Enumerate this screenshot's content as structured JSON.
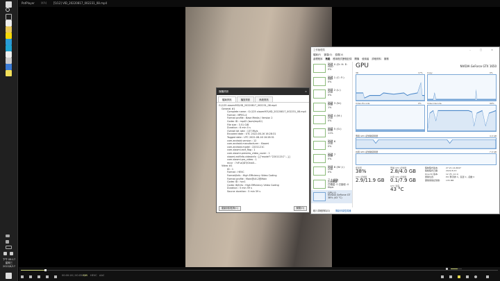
{
  "taskbar": {
    "clock": {
      "time": "下午 08:17",
      "weekday": "星期三",
      "date": "2022/8/17"
    }
  },
  "player": {
    "app": "PotPlayer",
    "format": "MP4",
    "file": "[5/12] VID_20220817_002231_08.mp4",
    "time": "00:00:16 / 00:05:59",
    "hw": "H/W",
    "video_codec": "HEVC",
    "audio_codec": "AAC",
    "progress": 0.05,
    "volume": 0.6,
    "colors": {
      "accent": "#cfd77a"
    }
  },
  "media_info": {
    "title": "媒體資訊",
    "close": "×",
    "tabs": [
      "檔案資訊",
      "播放資訊",
      "系統資訊"
    ],
    "file": "G:\\125 xiaomi93\\VID_20220817_002231_08.mp4",
    "general_header": "General #1",
    "general": [
      "Complete name : G:\\125 xiaomi93\\VID_20220817_002231_08.mp4",
      "Format : MPEG-4",
      "Format profile : Base Media / Version 2",
      "Codec ID : mp42 (isom/mp42)",
      "File size : 3.51 GiB",
      "Duration : 6 min 0 s",
      "Overall bit rate : 137 Mb/s",
      "Encoded date : UTC 2022-08-16 16:28:31",
      "Tagged date : UTC 2022-08-16 16:28:31",
      "com.android.version : 12",
      "com.android.manufacturer : Xiaomi",
      "com.android.model : 2201121C",
      "com.xiaomi.exif_flag : 1",
      "com.xiaomi.preview_video_cover : 1",
      "xiaomi.exifInfo.videoinfo : [{\"model\":\"2201121C\"...}]",
      "com.xiaomi.pro_video : 1",
      "mcvr : ?nP-aQD?/Ghw0..."
    ],
    "video_header": "Video #1",
    "video": [
      "ID : 1",
      "Format : HEVC",
      "Format/Info : High Efficiency Video Coding",
      "Format profile : Main@L6.2@Main",
      "Codec ID : hvc1",
      "Codec ID/Info : High Efficiency Video Coding",
      "Duration : 5 min 59 s",
      "Source duration : 5 min 59 s"
    ],
    "copy_button": "複製到剪貼簿(C)",
    "close_button": "關閉(O)"
  },
  "task_manager": {
    "title": "工作管理員",
    "window_controls": "– □ ×",
    "menu": [
      "檔案(F)",
      "選項(O)",
      "檢視(V)"
    ],
    "tabs": [
      "處理程序",
      "效能",
      "應用程式歷程記錄",
      "開機",
      "使用者",
      "詳細資料",
      "服務"
    ],
    "devices": [
      {
        "name": "磁碟 0 (D: H: E:",
        "type": "HDD",
        "value": "0%"
      },
      {
        "name": "磁碟 1 (C: F:)",
        "type": "SSD",
        "value": "0%"
      },
      {
        "name": "磁碟 2 (L:)",
        "type": "USB",
        "value": "0%"
      },
      {
        "name": "磁碟 3 (N:)",
        "type": "USB",
        "value": "1%"
      },
      {
        "name": "磁碟 4 (M:)",
        "type": "USB",
        "value": "0%"
      },
      {
        "name": "磁碟 5 (G:)",
        "type": "USB",
        "value": "11%"
      },
      {
        "name": "磁碟 6",
        "type": "USB",
        "value": "0%"
      },
      {
        "name": "磁碟 7",
        "type": "USB",
        "value": "0%"
      },
      {
        "name": "磁碟 8 (W: J:)",
        "type": "USB",
        "value": "0%"
      },
      {
        "name": "乙太網路",
        "type": "乙太網路",
        "value": "已傳送: 0 已接收: 0 Kbps"
      },
      {
        "name": "GPU 0",
        "type": "NVIDIA GeForce GT",
        "value": "38% (43 °C)"
      }
    ],
    "gpu": {
      "heading": "GPU",
      "model": "NVIDIA GeForce GTX 1650",
      "graphs": [
        {
          "label": "3D",
          "max": "17%"
        },
        {
          "label": "Copy",
          "max": "0%"
        },
        {
          "label": "Video Encode",
          "max": "0%"
        },
        {
          "label": "Video Decode",
          "max": "99%"
        }
      ],
      "dedicated_label": "專用 GPU 記憶體使用量",
      "dedicated_max": "4.0 GB",
      "shared_label": "共用 GPU 記憶體使用量",
      "shared_max": "7.9 GB",
      "stats": [
        {
          "label": "使用率",
          "value": "38%"
        },
        {
          "label": "專屬 GPU 記憶體",
          "value": "2.8/4.0 GB"
        },
        {
          "label": "GPU 記憶體",
          "value": "2.9/11.9 GB"
        },
        {
          "label": "共用 GPU 記憶體",
          "value": "0.1/7.9 GB"
        },
        {
          "label": "GPU 溫度",
          "value": "43 °C"
        }
      ],
      "info": [
        [
          "驅動程式版本:",
          "27.21.14.6647"
        ],
        [
          "驅動程式日期:",
          "2021/5/13"
        ],
        [
          "DirectX 版本:",
          "12 (FL 12.1)"
        ],
        [
          "實體位置:",
          "PCI 匯流排 4，裝置 0，函數 0"
        ],
        [
          "硬體保留記憶體:",
          "135 MB"
        ]
      ]
    },
    "footer": {
      "fewer": "較少詳細資料(D)",
      "monitor": "開啟資源監視器"
    }
  }
}
